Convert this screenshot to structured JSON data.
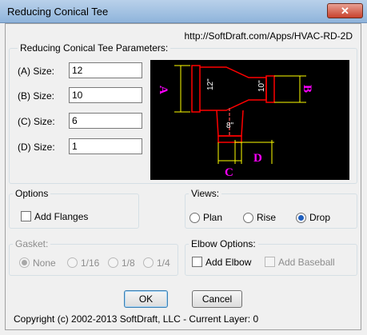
{
  "window": {
    "title": "Reducing Conical Tee",
    "close_glyph": "✕"
  },
  "url": "http://SoftDraft.com/Apps/HVAC-RD-2D",
  "params": {
    "label": "Reducing Conical Tee Parameters:",
    "fields": [
      {
        "label": "(A) Size:",
        "value": "12"
      },
      {
        "label": "(B) Size:",
        "value": "10"
      },
      {
        "label": "(C) Size:",
        "value": "6"
      },
      {
        "label": "(D) Size:",
        "value": "1"
      }
    ]
  },
  "diagram": {
    "label_a": "A",
    "label_b": "B",
    "label_c": "C",
    "label_d": "D",
    "dim_12": "12\"",
    "dim_10": "10\"",
    "dim_8": "8\"",
    "colors": {
      "pipe": "#ff0000",
      "dim": "#ffff00",
      "label": "#ff00ff",
      "text": "#ffffff"
    }
  },
  "options": {
    "label": "Options",
    "add_flanges": "Add Flanges",
    "add_flanges_checked": false
  },
  "views": {
    "label": "Views:",
    "items": [
      "Plan",
      "Rise",
      "Drop"
    ],
    "selected": "Drop"
  },
  "gasket": {
    "label": "Gasket:",
    "items": [
      "None",
      "1/16",
      "1/8",
      "1/4"
    ],
    "selected": "None",
    "disabled": true
  },
  "elbow": {
    "label": "Elbow Options:",
    "add_elbow": "Add Elbow",
    "add_baseball": "Add Baseball"
  },
  "buttons": {
    "ok": "OK",
    "cancel": "Cancel"
  },
  "footer": "Copyright (c) 2002-2013 SoftDraft, LLC - Current Layer: 0"
}
